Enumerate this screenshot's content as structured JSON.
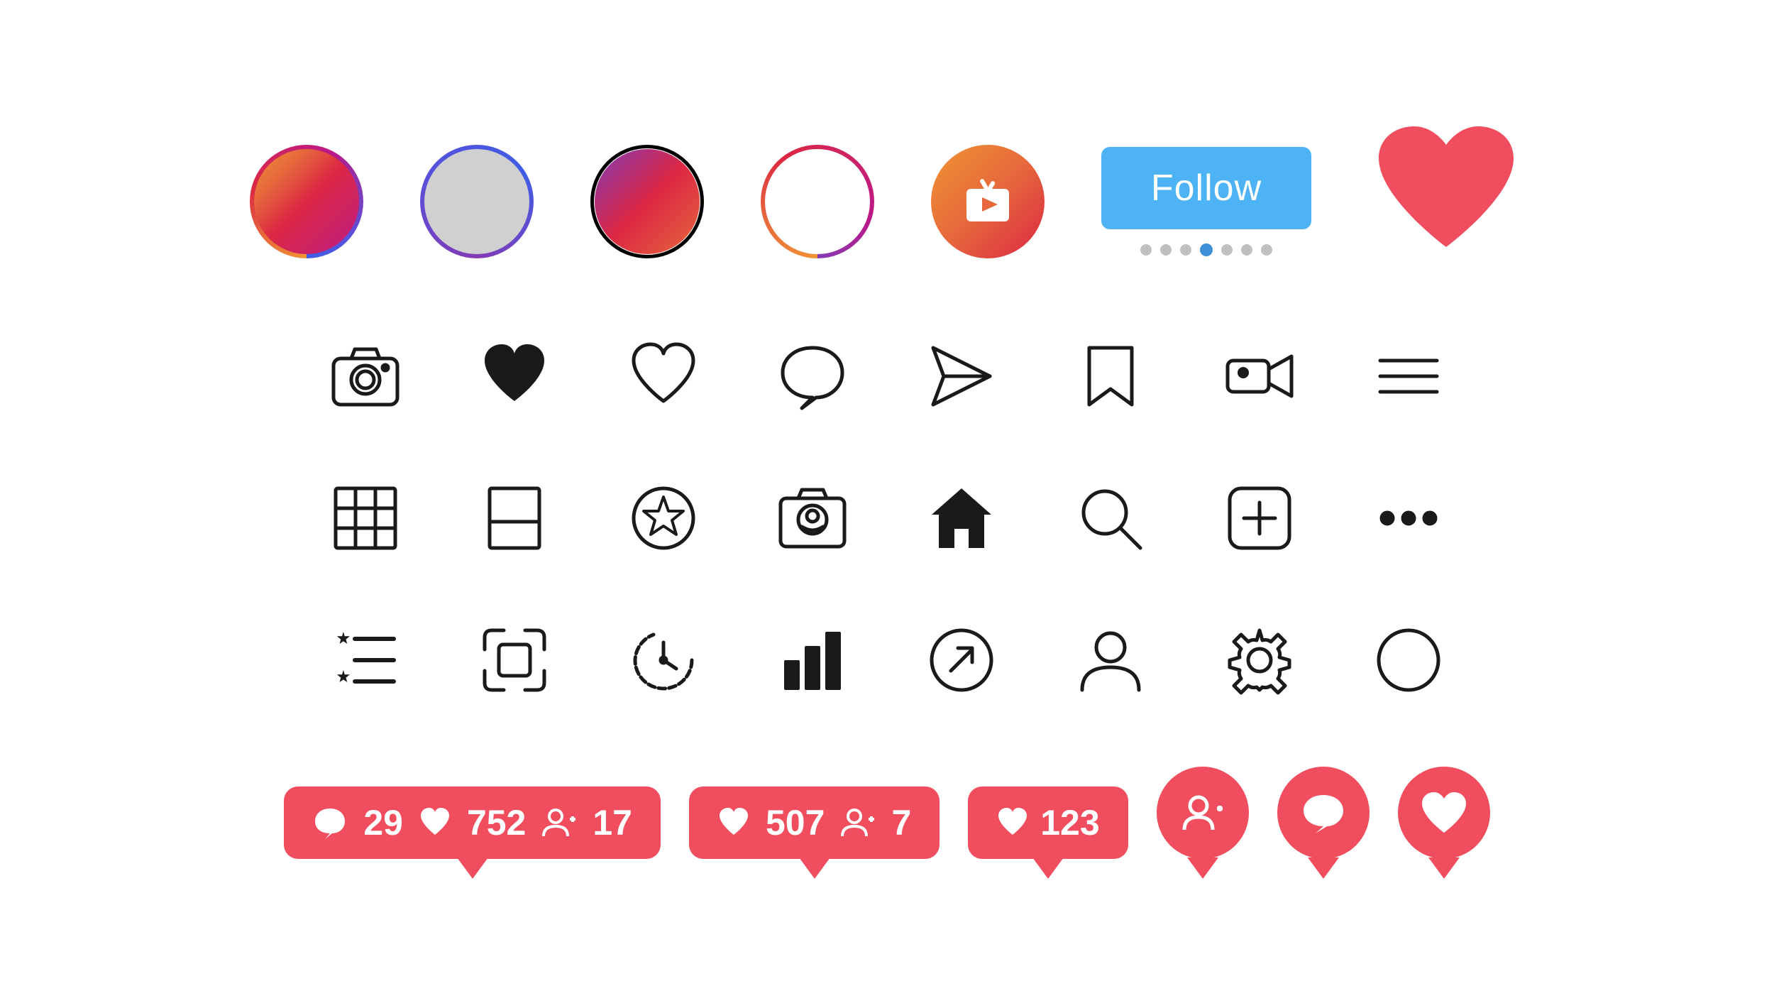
{
  "row1": {
    "circles": [
      {
        "id": "story1",
        "type": "gradient-filled",
        "label": "Story circle 1"
      },
      {
        "id": "story2",
        "type": "gradient-empty",
        "label": "Story circle 2"
      },
      {
        "id": "story3",
        "type": "dark-border-gradient",
        "label": "Story circle 3"
      },
      {
        "id": "story4",
        "type": "gradient-white",
        "label": "Story circle 4"
      },
      {
        "id": "igtv",
        "type": "igtv",
        "label": "IGTV"
      }
    ],
    "follow_button": "Follow",
    "dots": [
      1,
      2,
      3,
      4,
      5,
      6,
      7
    ],
    "active_dot": 4
  },
  "icons_row2": [
    {
      "name": "camera",
      "label": "Camera icon"
    },
    {
      "name": "heart-filled",
      "label": "Heart filled"
    },
    {
      "name": "heart-outline",
      "label": "Heart outline"
    },
    {
      "name": "comment",
      "label": "Comment bubble"
    },
    {
      "name": "send",
      "label": "Send / paper airplane"
    },
    {
      "name": "bookmark",
      "label": "Bookmark"
    },
    {
      "name": "video-camera",
      "label": "Video camera"
    },
    {
      "name": "menu",
      "label": "Hamburger menu"
    }
  ],
  "icons_row3": [
    {
      "name": "grid",
      "label": "Grid / 9 squares"
    },
    {
      "name": "single-post",
      "label": "Single post view"
    },
    {
      "name": "star-circle",
      "label": "Star circle / close friends"
    },
    {
      "name": "profile-photo",
      "label": "Profile photo / camera person"
    },
    {
      "name": "home",
      "label": "Home / house"
    },
    {
      "name": "search",
      "label": "Search / magnifier"
    },
    {
      "name": "add-post",
      "label": "Add post / plus square"
    },
    {
      "name": "more",
      "label": "More / three dots"
    }
  ],
  "icons_row4": [
    {
      "name": "activity",
      "label": "Activity / star list"
    },
    {
      "name": "screenshot",
      "label": "Screenshot / screen capture"
    },
    {
      "name": "clock-activity",
      "label": "Clock activity"
    },
    {
      "name": "bar-chart",
      "label": "Bar chart / insights"
    },
    {
      "name": "link-out",
      "label": "External link / arrow circle"
    },
    {
      "name": "profile",
      "label": "Profile / person"
    },
    {
      "name": "settings",
      "label": "Settings / gear"
    },
    {
      "name": "radio-unselected",
      "label": "Radio button unselected"
    }
  ],
  "notifications": [
    {
      "id": "notif1",
      "type": "multi",
      "items": [
        {
          "icon": "comment",
          "value": "29"
        },
        {
          "icon": "heart",
          "value": "752"
        },
        {
          "icon": "follow",
          "value": "17"
        }
      ]
    },
    {
      "id": "notif2",
      "type": "multi",
      "items": [
        {
          "icon": "heart",
          "value": "507"
        },
        {
          "icon": "follow",
          "value": "7"
        }
      ]
    },
    {
      "id": "notif3",
      "type": "single",
      "items": [
        {
          "icon": "heart",
          "value": "123"
        }
      ]
    },
    {
      "id": "notif4",
      "type": "icon-only",
      "icon": "follow"
    },
    {
      "id": "notif5",
      "type": "icon-only",
      "icon": "comment"
    },
    {
      "id": "notif6",
      "type": "icon-only",
      "icon": "heart"
    }
  ]
}
